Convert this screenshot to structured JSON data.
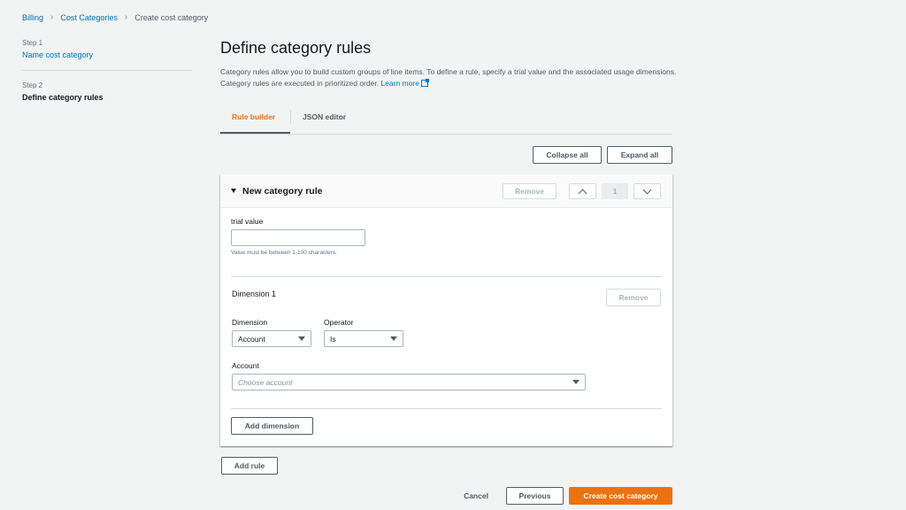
{
  "breadcrumb": {
    "items": [
      {
        "label": "Billing",
        "link": true
      },
      {
        "label": "Cost Categories",
        "link": true
      },
      {
        "label": "Create cost category",
        "link": false
      }
    ]
  },
  "steps": [
    {
      "step_label": "Step 1",
      "title": "Name cost category",
      "current": false
    },
    {
      "step_label": "Step 2",
      "title": "Define category rules",
      "current": true
    }
  ],
  "page": {
    "title": "Define category rules",
    "description": "Category rules allow you to build custom groups of line items. To define a rule, specify a trial value and the associated usage dimensions. Category rules are executed in prioritized order.",
    "learn_more": "Learn more"
  },
  "tabs": [
    {
      "label": "Rule builder",
      "active": true
    },
    {
      "label": "JSON editor",
      "active": false
    }
  ],
  "actions": {
    "collapse_all": "Collapse all",
    "expand_all": "Expand all"
  },
  "rule": {
    "title": "New category rule",
    "remove_label": "Remove",
    "order": "1",
    "trial_value": {
      "label": "trial value",
      "value": "",
      "hint": "Value must be between 1-100 characters."
    },
    "dimension": {
      "title": "Dimension 1",
      "remove_label": "Remove",
      "dimension_label": "Dimension",
      "dimension_value": "Account",
      "operator_label": "Operator",
      "operator_value": "Is",
      "account_label": "Account",
      "account_placeholder": "Choose account"
    },
    "add_dimension": "Add dimension"
  },
  "add_rule": "Add rule",
  "footer": {
    "cancel": "Cancel",
    "previous": "Previous",
    "create": "Create cost category"
  },
  "colors": {
    "accent": "#ec7211",
    "link": "#0073bb",
    "background": "#f2f3f3"
  }
}
